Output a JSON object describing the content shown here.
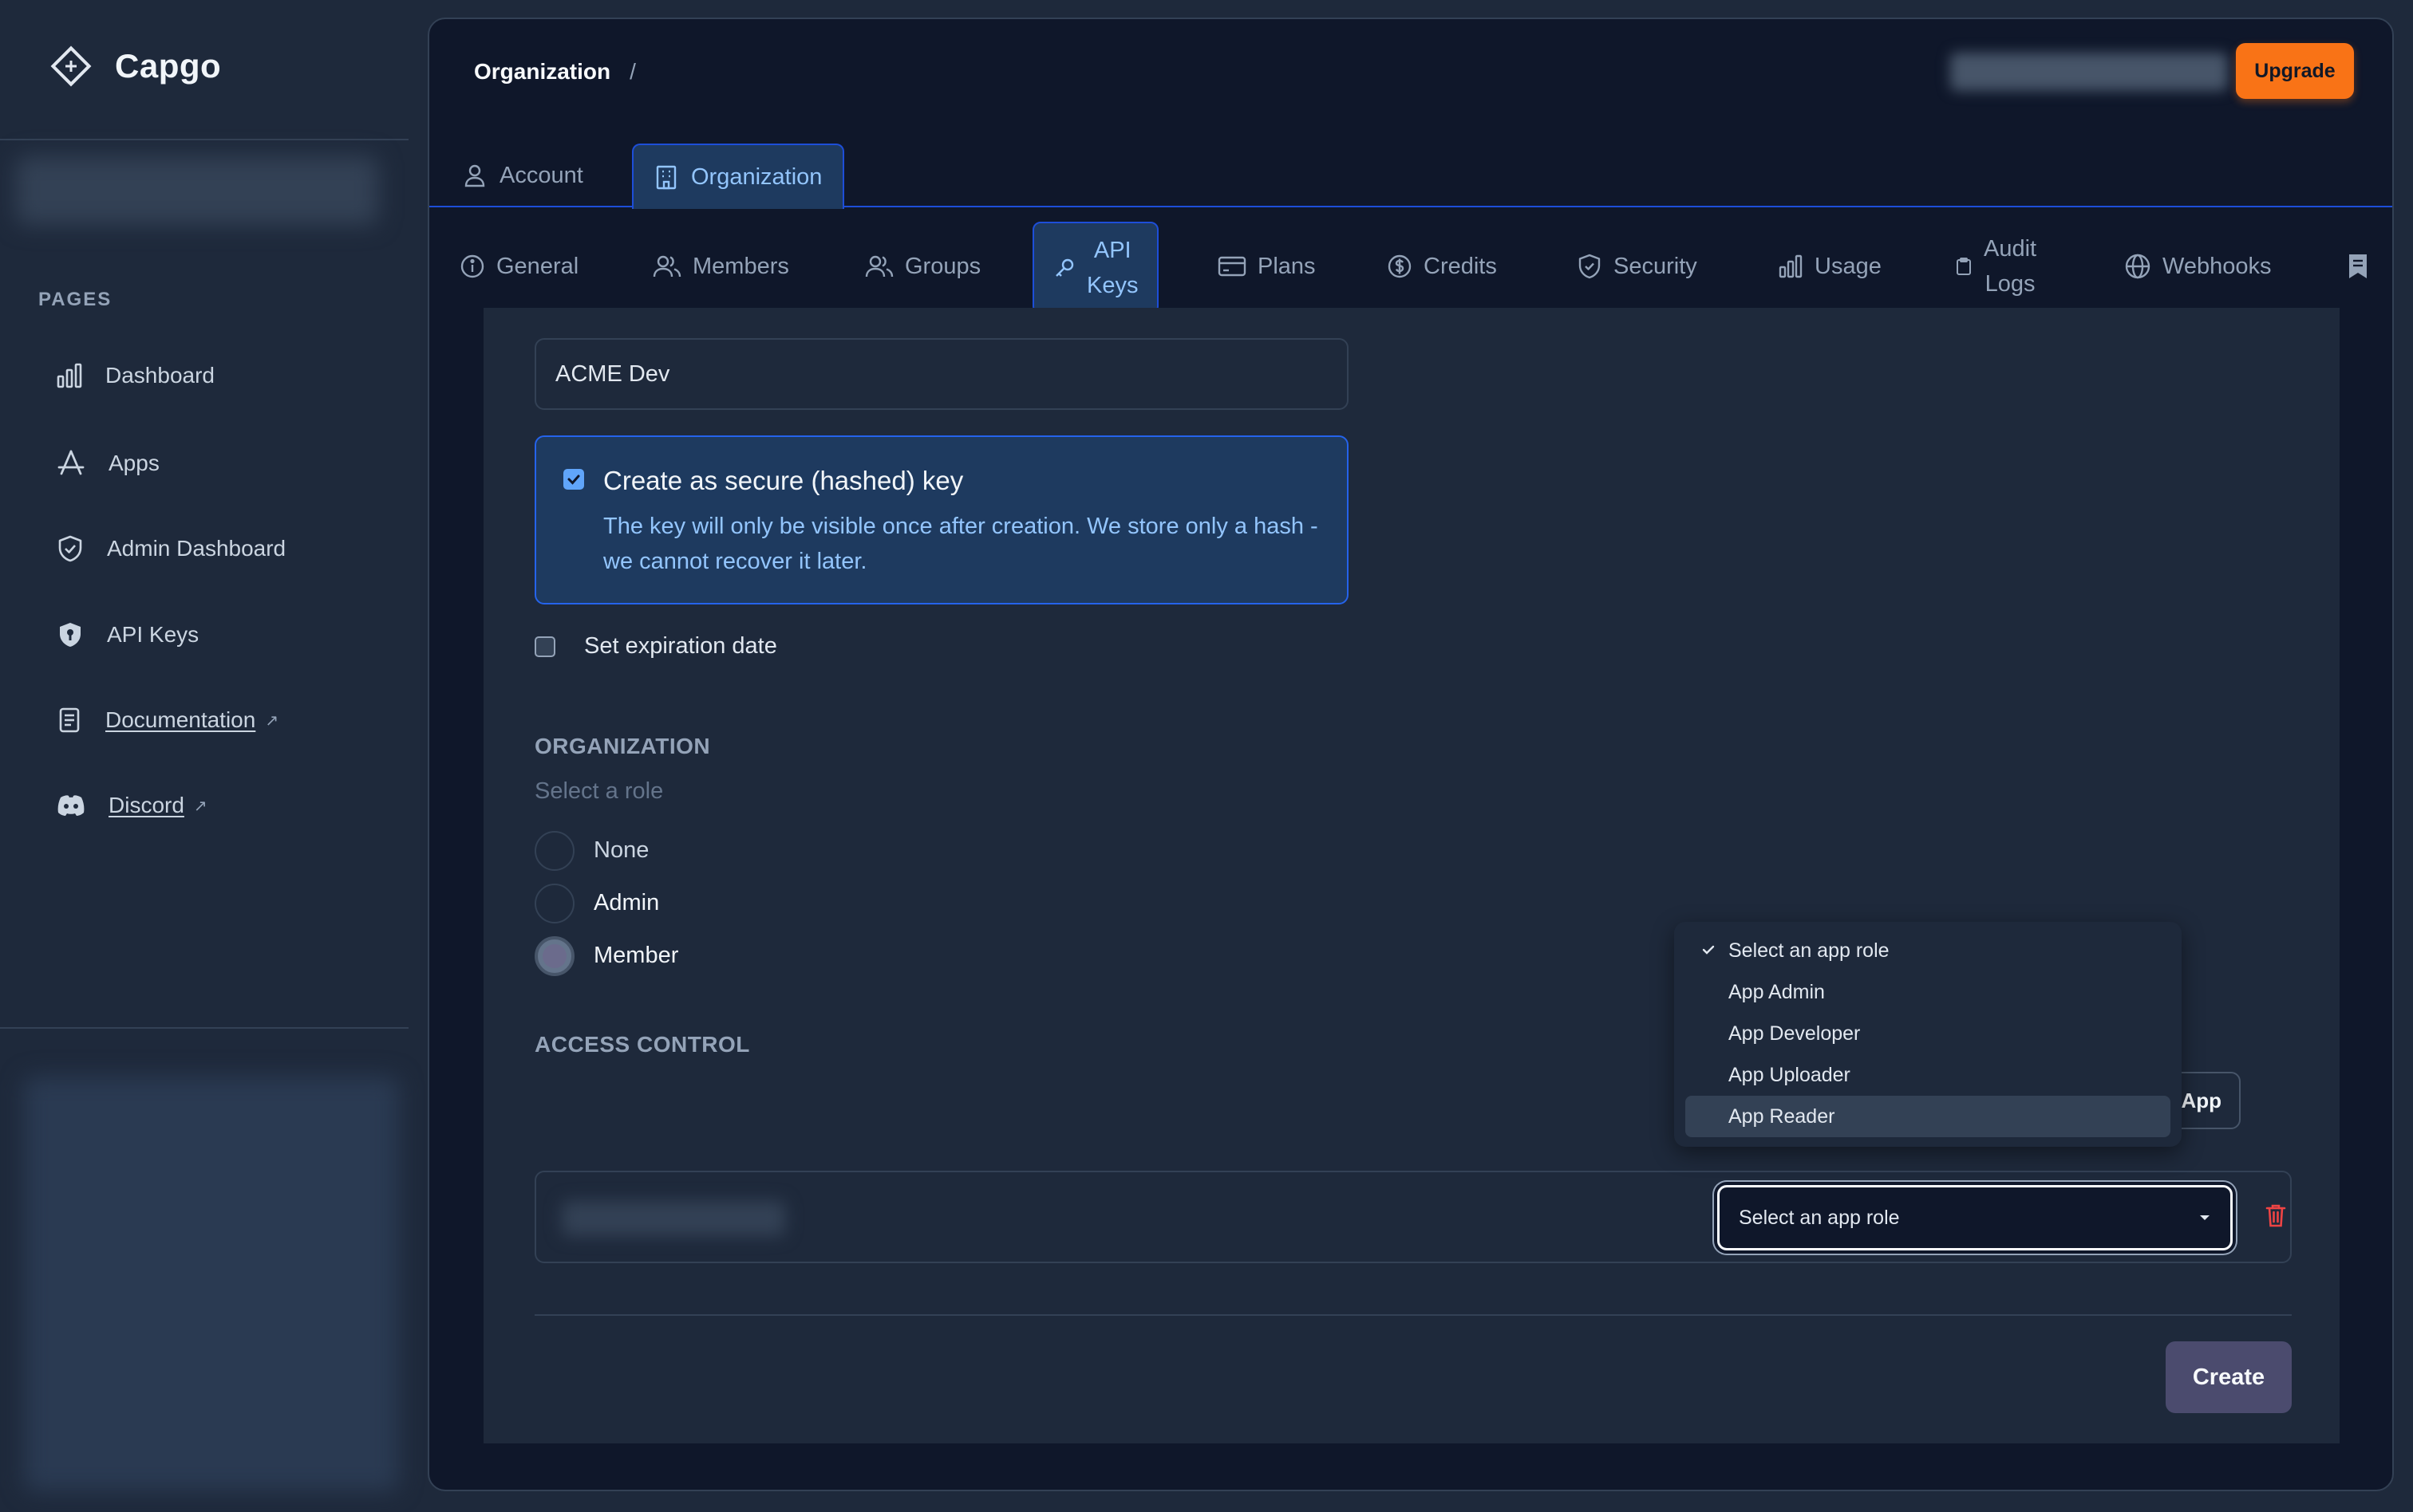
{
  "app": {
    "name": "Capgo"
  },
  "sidebar": {
    "section_label": "PAGES",
    "items": [
      {
        "label": "Dashboard",
        "icon": "bar-chart-icon"
      },
      {
        "label": "Apps",
        "icon": "app-store-icon"
      },
      {
        "label": "Admin Dashboard",
        "icon": "shield-check-icon"
      },
      {
        "label": "API Keys",
        "icon": "shield-key-icon"
      },
      {
        "label": "Documentation",
        "icon": "document-icon",
        "external": true
      },
      {
        "label": "Discord",
        "icon": "discord-icon",
        "external": true
      }
    ]
  },
  "header": {
    "breadcrumb": [
      "Organization",
      "/"
    ],
    "upgrade_label": "Upgrade"
  },
  "top_tabs": [
    {
      "label": "Account",
      "icon": "user-icon",
      "active": false
    },
    {
      "label": "Organization",
      "icon": "building-icon",
      "active": true
    }
  ],
  "sub_tabs": [
    {
      "label": "General",
      "icon": "info-icon"
    },
    {
      "label": "Members",
      "icon": "users-icon"
    },
    {
      "label": "Groups",
      "icon": "users-icon"
    },
    {
      "label_line1": "API",
      "label_line2": "Keys",
      "icon": "key-icon",
      "active": true
    },
    {
      "label": "Plans",
      "icon": "credit-card-icon"
    },
    {
      "label": "Credits",
      "icon": "dollar-circle-icon"
    },
    {
      "label": "Security",
      "icon": "shield-icon"
    },
    {
      "label": "Usage",
      "icon": "bar-chart-icon"
    },
    {
      "label_line1": "Audit",
      "label_line2": "Logs",
      "icon": "clipboard-icon"
    },
    {
      "label": "Webhooks",
      "icon": "globe-icon"
    }
  ],
  "form": {
    "key_name_value": "ACME Dev",
    "secure": {
      "checked": true,
      "title": "Create as secure (hashed) key",
      "description": "The key will only be visible once after creation. We store only a hash - we cannot recover it later."
    },
    "expiration": {
      "checked": false,
      "label": "Set expiration date"
    },
    "organization": {
      "title": "ORGANIZATION",
      "subtitle": "Select a role",
      "roles": [
        {
          "label": "None",
          "selected": false
        },
        {
          "label": "Admin",
          "selected": false
        },
        {
          "label": "Member",
          "selected": true
        }
      ]
    },
    "access_control": {
      "title": "ACCESS CONTROL",
      "add_app_label": "Add App",
      "role_select_value": "Select an app role",
      "dropdown_options": [
        {
          "label": "Select an app role",
          "checked": true
        },
        {
          "label": "App Admin",
          "checked": false
        },
        {
          "label": "App Developer",
          "checked": false
        },
        {
          "label": "App Uploader",
          "checked": false
        },
        {
          "label": "App Reader",
          "checked": false,
          "highlighted": true
        }
      ]
    },
    "create_label": "Create"
  },
  "colors": {
    "accent": "#f97316",
    "link": "#93c5fd",
    "panel": "#0f172a",
    "card": "#1e293b",
    "danger": "#ef4444"
  }
}
